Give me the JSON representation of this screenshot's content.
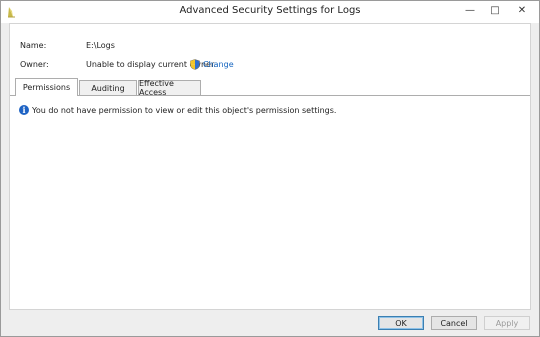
{
  "window": {
    "title": "Advanced Security Settings for Logs",
    "minimize_glyph": "—",
    "maximize_glyph": "□",
    "close_glyph": "✕"
  },
  "fields": {
    "name_label": "Name:",
    "name_value": "E:\\Logs",
    "owner_label": "Owner:",
    "owner_value": "Unable to display current owner.",
    "change_label": "Change"
  },
  "tabs": [
    {
      "label": "Permissions",
      "active": true
    },
    {
      "label": "Auditing",
      "active": false
    },
    {
      "label": "Effective Access",
      "active": false
    }
  ],
  "panel": {
    "info_icon": "i",
    "message": "You do not have permission to view or edit this object's permission settings."
  },
  "buttons": {
    "ok": "OK",
    "cancel": "Cancel",
    "apply": "Apply"
  },
  "icons": {
    "app": "folder-security-icon",
    "shield": "uac-shield-icon",
    "info": "info-icon"
  },
  "colors": {
    "link": "#1565c0",
    "info_icon": "#1e63c4",
    "ok_border": "#3c7fb1"
  }
}
